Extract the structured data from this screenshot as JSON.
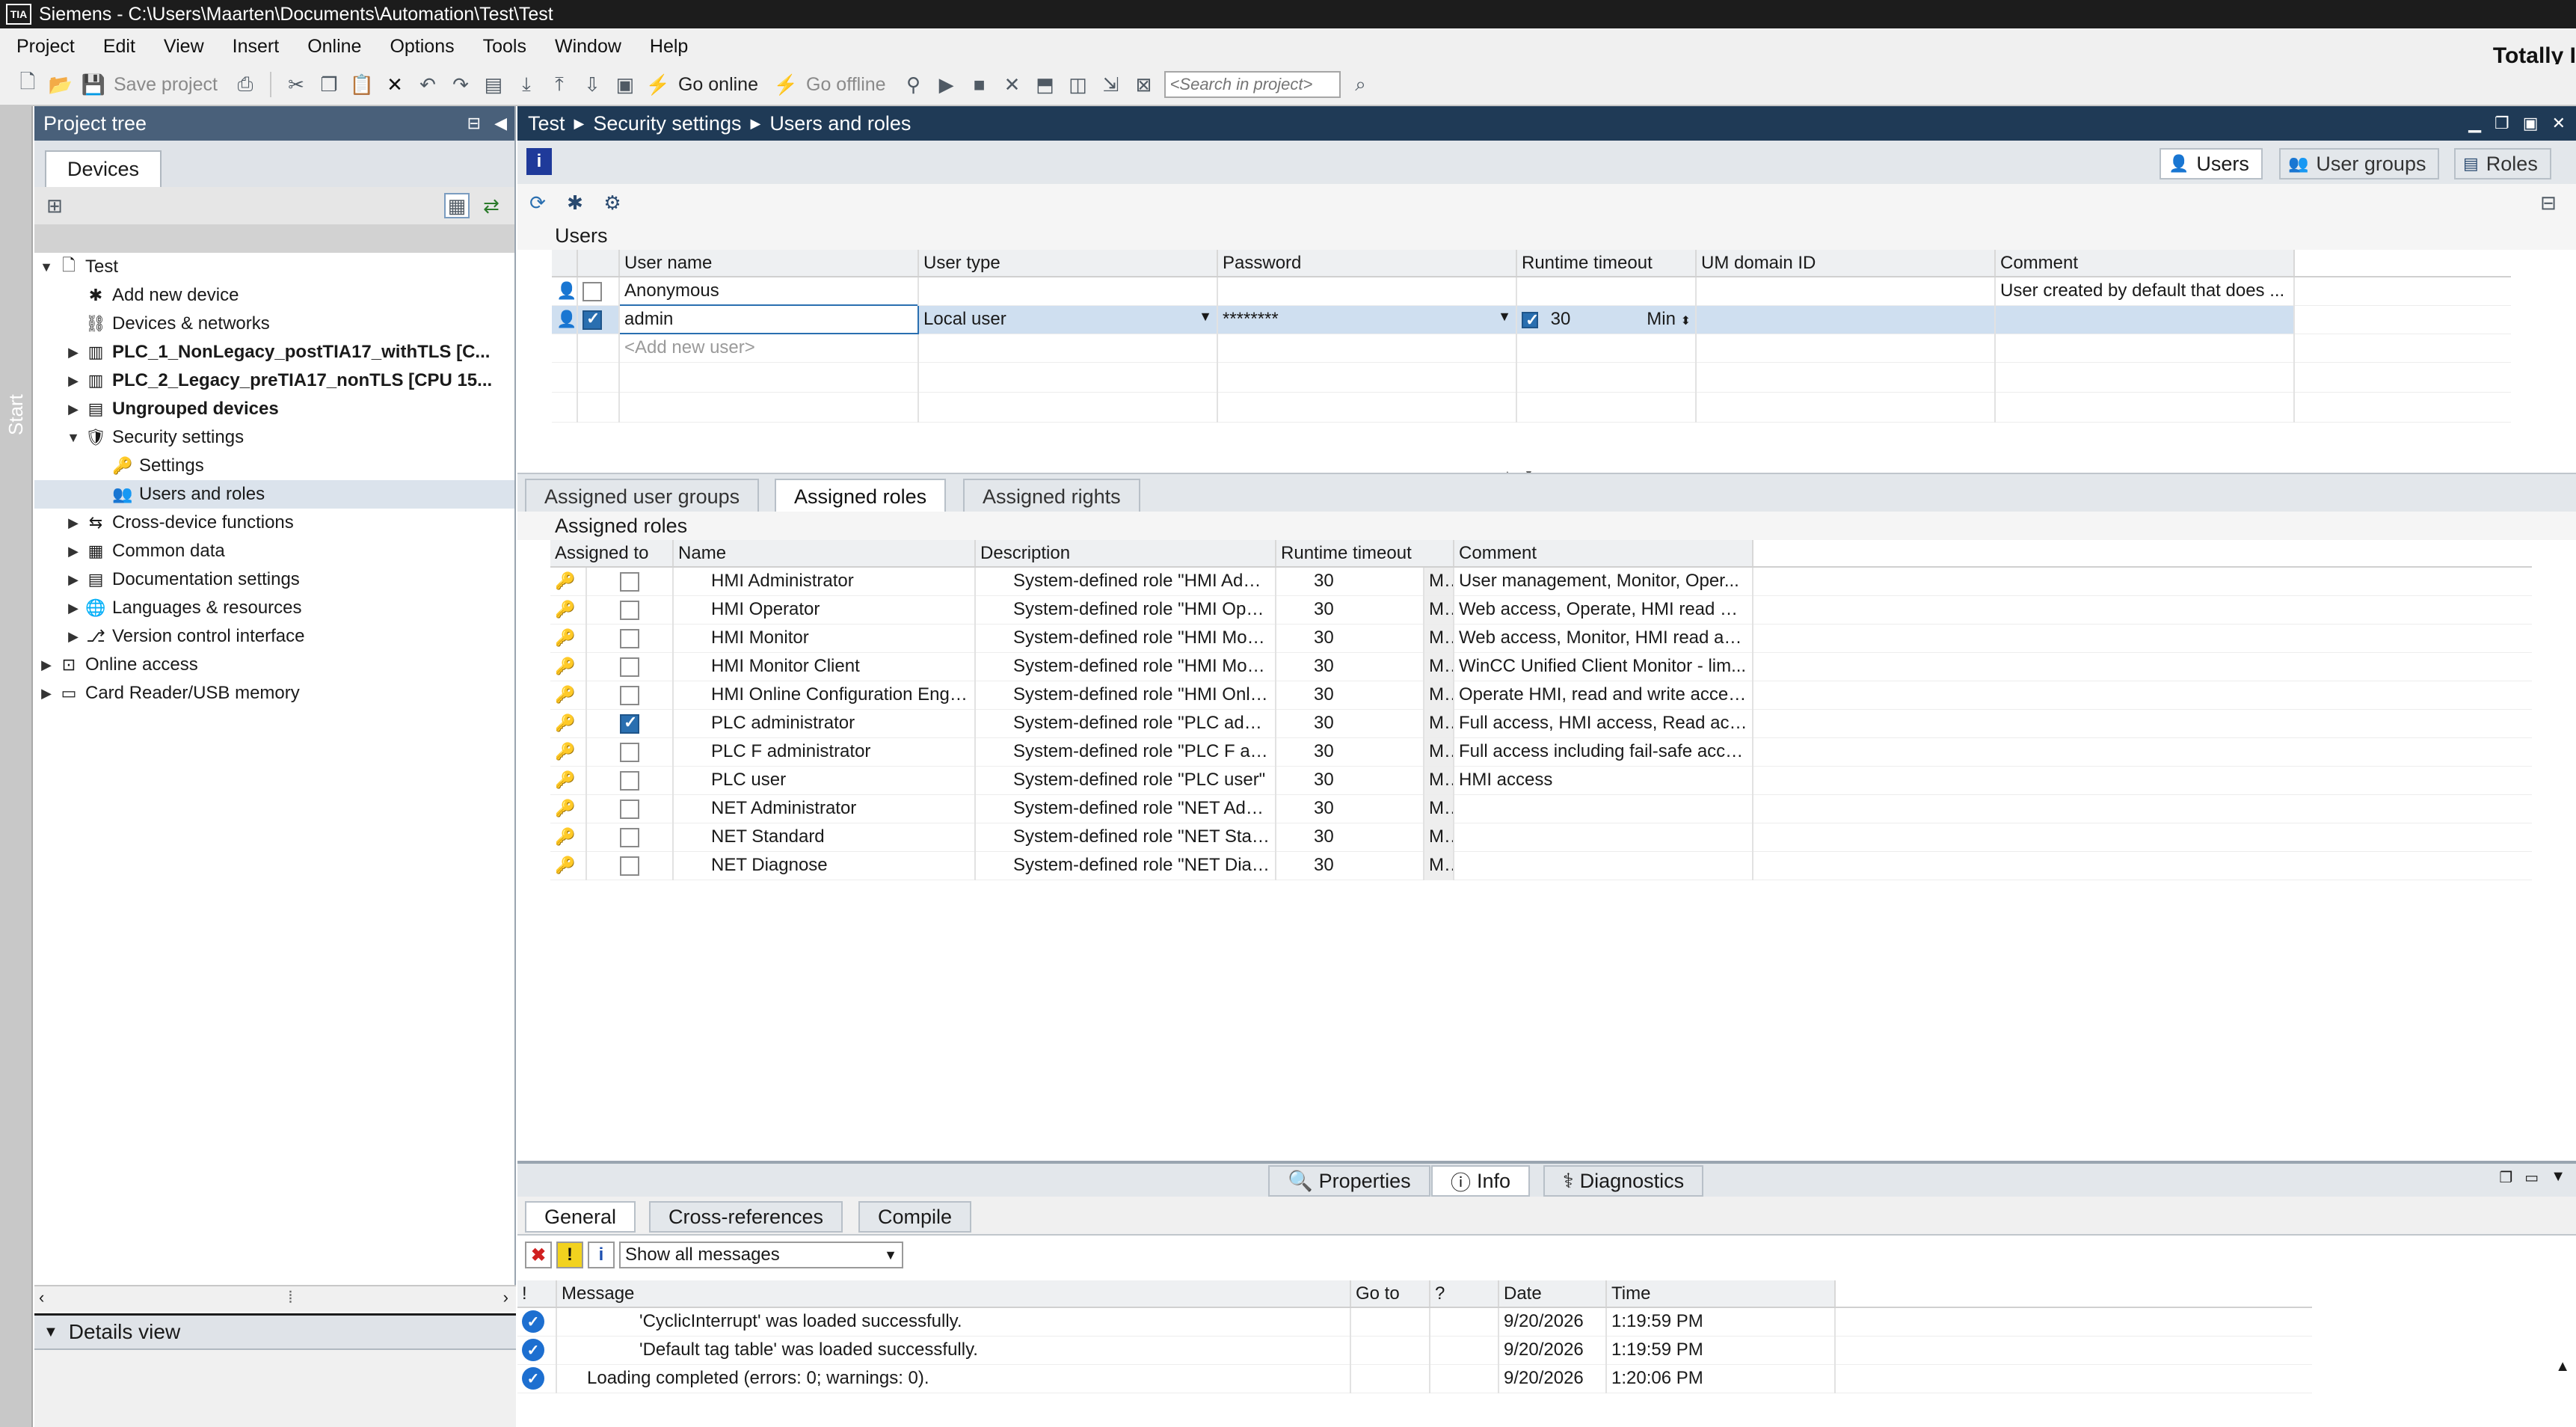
{
  "app": {
    "title": "Siemens  -  C:\\Users\\Maarten\\Documents\\Automation\\Test\\Test",
    "logo_text": "TIA",
    "brand": "Totally I"
  },
  "menu": [
    "Project",
    "Edit",
    "View",
    "Insert",
    "Online",
    "Options",
    "Tools",
    "Window",
    "Help"
  ],
  "toolbar": {
    "save_project": "Save project",
    "go_online": "Go online",
    "go_offline": "Go offline",
    "search_placeholder": "<Search in project>"
  },
  "start_strip": "Start",
  "project_tree": {
    "title": "Project tree",
    "tab": "Devices",
    "items": [
      {
        "label": "Test",
        "level": 0,
        "arrow": "▼",
        "icon": "project-icon",
        "bold": false
      },
      {
        "label": "Add new device",
        "level": 1,
        "arrow": "",
        "icon": "add-device-icon",
        "bold": false
      },
      {
        "label": "Devices & networks",
        "level": 1,
        "arrow": "",
        "icon": "network-icon",
        "bold": false
      },
      {
        "label": "PLC_1_NonLegacy_postTIA17_withTLS [C...",
        "level": 1,
        "arrow": "▶",
        "icon": "plc-icon",
        "bold": true
      },
      {
        "label": "PLC_2_Legacy_preTIA17_nonTLS [CPU 15...",
        "level": 1,
        "arrow": "▶",
        "icon": "plc-icon",
        "bold": true
      },
      {
        "label": "Ungrouped devices",
        "level": 1,
        "arrow": "▶",
        "icon": "folder-icon",
        "bold": true
      },
      {
        "label": "Security settings",
        "level": 1,
        "arrow": "▼",
        "icon": "security-icon",
        "bold": false
      },
      {
        "label": "Settings",
        "level": 2,
        "arrow": "",
        "icon": "settings-key-icon",
        "bold": false
      },
      {
        "label": "Users and roles",
        "level": 2,
        "arrow": "",
        "icon": "users-icon",
        "bold": false,
        "selected": true
      },
      {
        "label": "Cross-device functions",
        "level": 1,
        "arrow": "▶",
        "icon": "cross-device-icon",
        "bold": false
      },
      {
        "label": "Common data",
        "level": 1,
        "arrow": "▶",
        "icon": "common-data-icon",
        "bold": false
      },
      {
        "label": "Documentation settings",
        "level": 1,
        "arrow": "▶",
        "icon": "documentation-icon",
        "bold": false
      },
      {
        "label": "Languages & resources",
        "level": 1,
        "arrow": "▶",
        "icon": "languages-icon",
        "bold": false
      },
      {
        "label": "Version control interface",
        "level": 1,
        "arrow": "▶",
        "icon": "version-control-icon",
        "bold": false
      },
      {
        "label": "Online access",
        "level": 0,
        "arrow": "▶",
        "icon": "online-access-icon",
        "bold": false
      },
      {
        "label": "Card Reader/USB memory",
        "level": 0,
        "arrow": "▶",
        "icon": "card-reader-icon",
        "bold": false
      }
    ]
  },
  "details_view": "Details view",
  "editor": {
    "breadcrumb": [
      "Test",
      "Security settings",
      "Users and roles"
    ],
    "tabs": [
      "Users",
      "User groups",
      "Roles"
    ],
    "users_title": "Users",
    "users_columns": [
      "User name",
      "User type",
      "Password",
      "Runtime timeout",
      "UM domain ID",
      "Comment"
    ],
    "users": [
      {
        "name": "Anonymous",
        "checked": false,
        "type": "",
        "password": "",
        "timeout": "",
        "unit": "",
        "comment": "User created by default that does ..."
      },
      {
        "name": "admin",
        "checked": true,
        "type": "Local user",
        "password": "********",
        "timeout": "30",
        "unit": "Min",
        "comment": ""
      }
    ],
    "add_user": "<Add new user>",
    "lower_tabs": [
      "Assigned user groups",
      "Assigned roles",
      "Assigned rights"
    ],
    "roles_title": "Assigned roles",
    "roles_columns": [
      "Assigned to",
      "Name",
      "Description",
      "Runtime timeout",
      "Comment"
    ],
    "roles": [
      {
        "name": "HMI Administrator",
        "assigned": false,
        "desc": "System-defined role \"HMI Adminis...",
        "timeout": "30",
        "unit": "Min",
        "comment": "User management, Monitor, Oper..."
      },
      {
        "name": "HMI Operator",
        "assigned": false,
        "desc": "System-defined role \"HMI Operator\"",
        "timeout": "30",
        "unit": "Min",
        "comment": "Web access, Operate, HMI read an..."
      },
      {
        "name": "HMI Monitor",
        "assigned": false,
        "desc": "System-defined role \"HMI Monitor\"",
        "timeout": "30",
        "unit": "Min",
        "comment": "Web access, Monitor, HMI read ac..."
      },
      {
        "name": "HMI Monitor Client",
        "assigned": false,
        "desc": "System-defined role \"HMI Monitor...",
        "timeout": "30",
        "unit": "Min",
        "comment": "WinCC Unified Client Monitor - lim..."
      },
      {
        "name": "HMI Online Configuration Engineer",
        "assigned": false,
        "desc": "System-defined role \"HMI Online C...",
        "timeout": "30",
        "unit": "Min",
        "comment": "Operate HMI, read and write acces..."
      },
      {
        "name": "PLC administrator",
        "assigned": true,
        "desc": "System-defined role \"PLC administ...",
        "timeout": "30",
        "unit": "Min",
        "comment": "Full access, HMI access, Read access"
      },
      {
        "name": "PLC F administrator",
        "assigned": false,
        "desc": "System-defined role \"PLC F admini...",
        "timeout": "30",
        "unit": "Min",
        "comment": "Full access including fail-safe acce..."
      },
      {
        "name": "PLC user",
        "assigned": false,
        "desc": "System-defined role \"PLC user\"",
        "timeout": "30",
        "unit": "Min",
        "comment": "HMI access"
      },
      {
        "name": "NET Administrator",
        "assigned": false,
        "desc": "System-defined role \"NET Adminis...",
        "timeout": "30",
        "unit": "Min",
        "comment": ""
      },
      {
        "name": "NET Standard",
        "assigned": false,
        "desc": "System-defined role \"NET Standard\"",
        "timeout": "30",
        "unit": "Min",
        "comment": ""
      },
      {
        "name": "NET Diagnose",
        "assigned": false,
        "desc": "System-defined role \"NET Diagnose\"",
        "timeout": "30",
        "unit": "Min",
        "comment": ""
      }
    ]
  },
  "inspector": {
    "top_tabs": [
      "Properties",
      "Info",
      "Diagnostics"
    ],
    "tabs": [
      "General",
      "Cross-references",
      "Compile"
    ],
    "filter": "Show all messages",
    "columns": [
      "!",
      "Message",
      "Go to",
      "?",
      "Date",
      "Time"
    ],
    "messages": [
      {
        "message": "'CyclicInterrupt' was loaded successfully.",
        "date": "9/20/2026",
        "time": "1:19:59 PM"
      },
      {
        "message": "'Default tag table' was loaded successfully.",
        "date": "9/20/2026",
        "time": "1:19:59 PM"
      },
      {
        "message": "Loading completed (errors: 0; warnings: 0).",
        "date": "9/20/2026",
        "time": "1:20:06 PM"
      }
    ]
  },
  "colors": {
    "accent": "#1f3a56",
    "panel_header": "#49607a",
    "selection": "#cfdff0"
  }
}
